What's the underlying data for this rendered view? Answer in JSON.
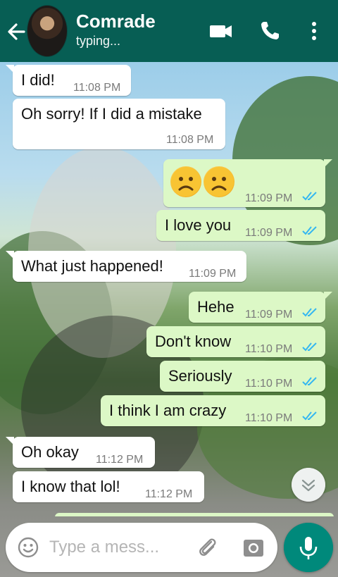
{
  "colors": {
    "header": "#075e54",
    "incoming": "#ffffff",
    "outgoing": "#dcf8c6",
    "tick_read": "#34b7f1",
    "mic": "#00897b"
  },
  "header": {
    "contact_name": "Comrade",
    "status": "typing...",
    "icons": [
      "back-arrow-icon",
      "avatar",
      "video-call-icon",
      "phone-icon",
      "more-vert-icon"
    ]
  },
  "messages": [
    {
      "dir": "in",
      "text": "I did!",
      "time": "11:08 PM"
    },
    {
      "dir": "in",
      "text": "Oh sorry! If I did a mistake",
      "time": "11:08 PM"
    },
    {
      "dir": "out",
      "text": "",
      "emoji": [
        "worried-face",
        "worried-face"
      ],
      "time": "11:09 PM",
      "read": true
    },
    {
      "dir": "out",
      "text": "I love you",
      "time": "11:09 PM",
      "read": true
    },
    {
      "dir": "in",
      "text": "What just happened!",
      "time": "11:09 PM"
    },
    {
      "dir": "out",
      "text": "Hehe",
      "time": "11:09 PM",
      "read": true
    },
    {
      "dir": "out",
      "text": "Don't know",
      "time": "11:10 PM",
      "read": true
    },
    {
      "dir": "out",
      "text": "Seriously",
      "time": "11:10 PM",
      "read": true
    },
    {
      "dir": "out",
      "text": "I think I am crazy",
      "time": "11:10 PM",
      "read": true
    },
    {
      "dir": "in",
      "text": "Oh okay",
      "time": "11:12 PM"
    },
    {
      "dir": "in",
      "text": "I know that lol!",
      "time": "11:12 PM"
    }
  ],
  "composer": {
    "placeholder": "Type a mess...",
    "icons": [
      "emoji-icon",
      "attach-icon",
      "camera-icon",
      "mic-icon"
    ]
  }
}
